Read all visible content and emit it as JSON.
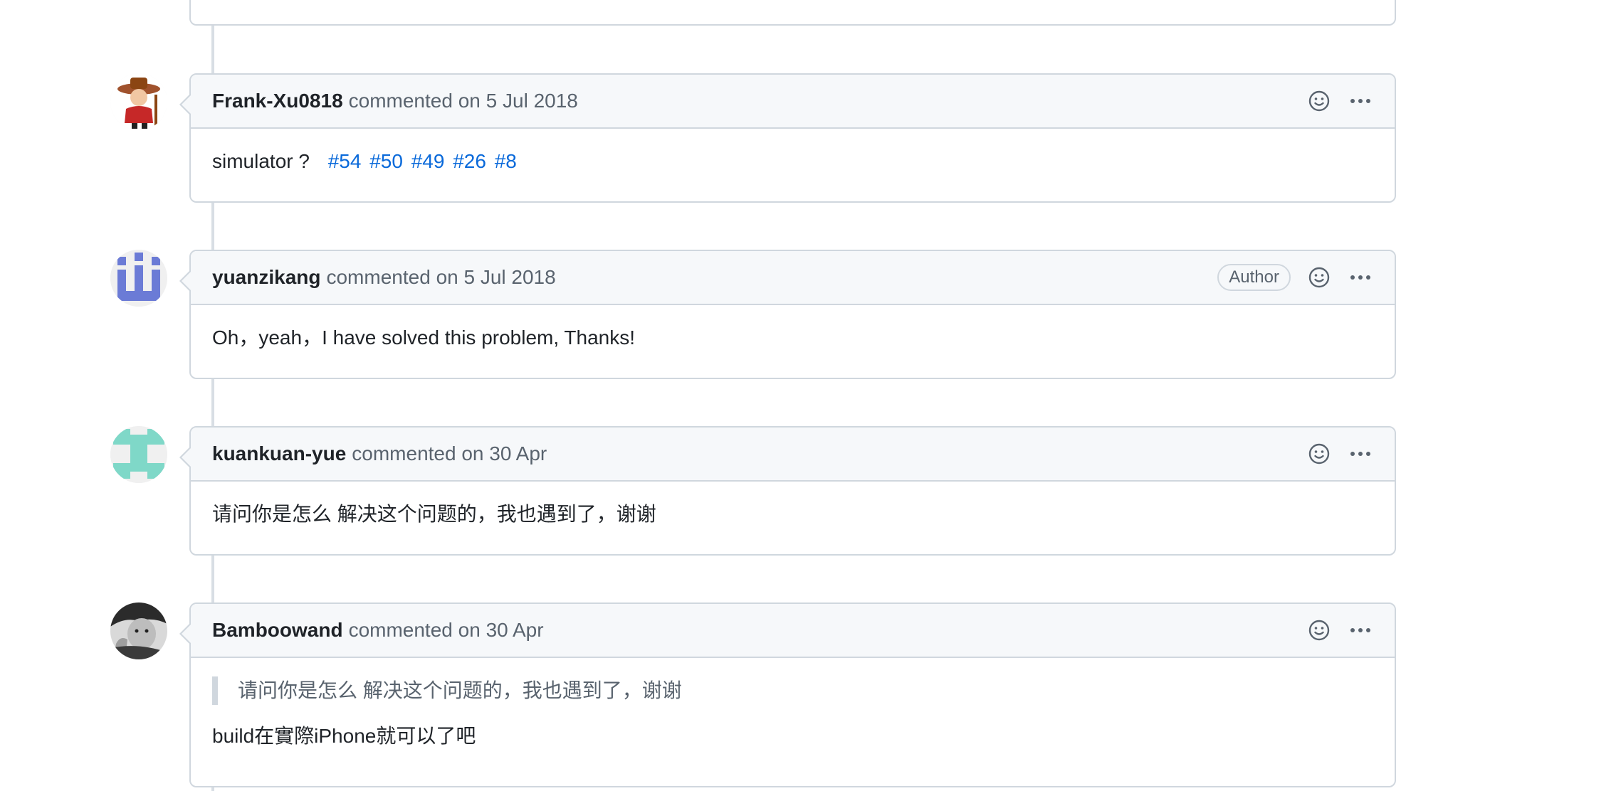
{
  "comments": [
    {
      "author": "Frank-Xu0818",
      "action": "commented",
      "date": "on 5 Jul 2018",
      "body": "simulator ?",
      "issue_links": [
        "#54",
        "#50",
        "#49",
        "#26",
        "#8"
      ]
    },
    {
      "author": "yuanzikang",
      "action": "commented",
      "date": "on 5 Jul 2018",
      "badge": "Author",
      "body": "Oh，yeah，I have solved this problem, Thanks!"
    },
    {
      "author": "kuankuan-yue",
      "action": "commented",
      "date": "on 30 Apr",
      "body": "请问你是怎么 解决这个问题的，我也遇到了，谢谢"
    },
    {
      "author": "Bamboowand",
      "action": "commented",
      "date": "on 30 Apr",
      "quote": "请问你是怎么 解决这个问题的，我也遇到了，谢谢",
      "body": "build在實際iPhone就可以了吧"
    }
  ],
  "icons": {
    "reaction": "smiley-icon",
    "more": "kebab-horizontal-icon"
  },
  "colors": {
    "link": "#0969da",
    "border": "#d0d7de",
    "header_bg": "#f6f8fa",
    "muted_text": "#59636e",
    "avatar_yuanzikang": "#6b7bd6",
    "avatar_kuankuan": "#7fd8c8"
  }
}
